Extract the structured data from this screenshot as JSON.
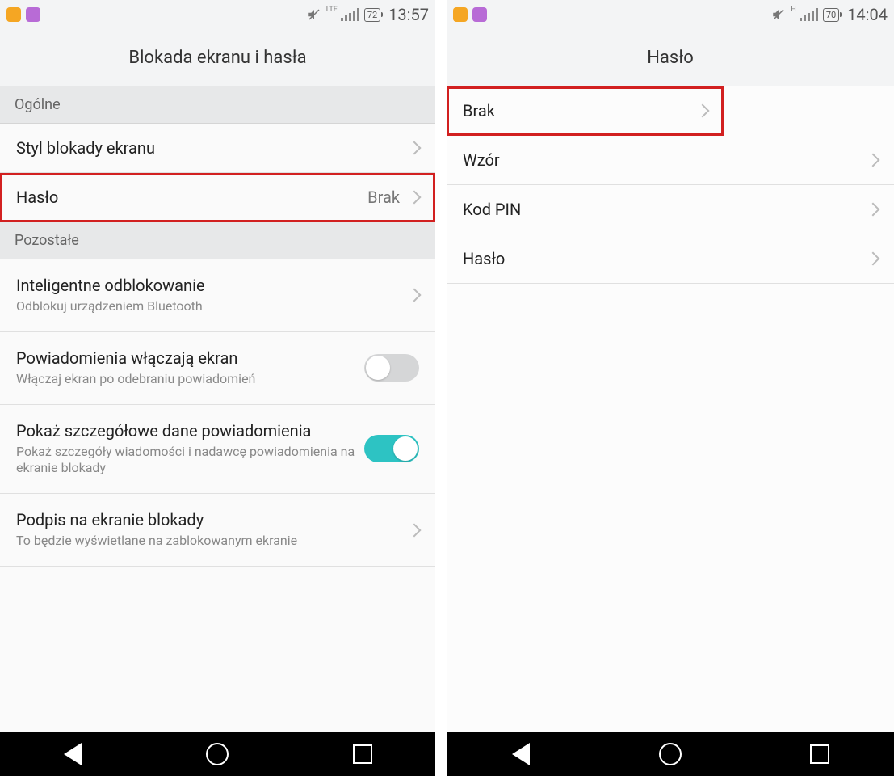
{
  "left": {
    "statusbar": {
      "network": "LTE",
      "battery": "72",
      "time": "13:57"
    },
    "title": "Blokada ekranu i hasła",
    "sections": {
      "general_header": "Ogólne",
      "style": {
        "label": "Styl blokady ekranu"
      },
      "password": {
        "label": "Hasło",
        "value": "Brak"
      },
      "other_header": "Pozostałe",
      "smart_unlock": {
        "label": "Inteligentne odblokowanie",
        "sub": "Odblokuj urządzeniem Bluetooth"
      },
      "notif_wake": {
        "label": "Powiadomienia włączają ekran",
        "sub": "Włączaj ekran po odebraniu powiadomień"
      },
      "notif_detail": {
        "label": "Pokaż szczegółowe dane powiadomienia",
        "sub": "Pokaż szczegóły wiadomości i nadawcę powiadomienia na ekranie blokady"
      },
      "signature": {
        "label": "Podpis na ekranie blokady",
        "sub": "To będzie wyświetlane na zablokowanym ekranie"
      }
    }
  },
  "right": {
    "statusbar": {
      "network": "H",
      "battery": "70",
      "time": "14:04"
    },
    "title": "Hasło",
    "items": {
      "none": "Brak",
      "pattern": "Wzór",
      "pin": "Kod PIN",
      "password": "Hasło"
    }
  }
}
